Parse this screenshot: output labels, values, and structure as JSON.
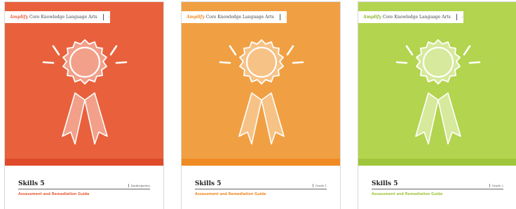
{
  "brand": {
    "logo_text": "Amplify",
    "program": "Core Knowledge Language Arts"
  },
  "covers": [
    {
      "title": "Skills 5",
      "grade": "Kindergarten",
      "subtitle": "Assessment and Remediation Guide",
      "colors": {
        "background": "#e8613c",
        "stripe": "#df4a2a",
        "medal": "#f2a08a",
        "accent": "#e8613c"
      }
    },
    {
      "title": "Skills 5",
      "grade": "Grade 1",
      "subtitle": "Assessment and Remediation Guide",
      "colors": {
        "background": "#f0a043",
        "stripe": "#f08a22",
        "medal": "#f7c286",
        "accent": "#f08a22"
      }
    },
    {
      "title": "Skills 5",
      "grade": "Grade 2",
      "subtitle": "Assessment and Remediation Guide",
      "colors": {
        "background": "#b3d44f",
        "stripe": "#9fc63a",
        "medal": "#d6e99c",
        "accent": "#9fc63a"
      }
    }
  ]
}
